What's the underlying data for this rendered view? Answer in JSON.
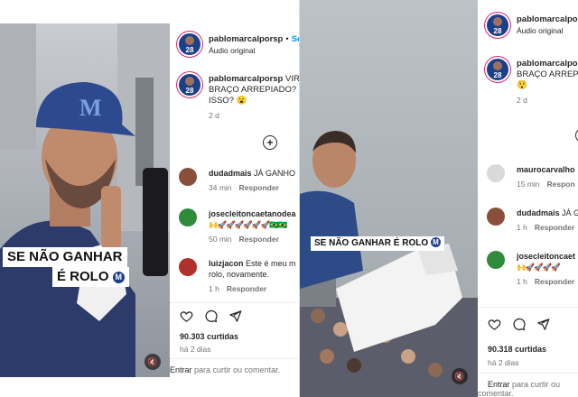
{
  "left": {
    "username": "pablomarcalporsp",
    "separator": "•",
    "follow": "Se",
    "audio": "Áudio original",
    "avatar_number": "28",
    "caption": {
      "lines": [
        "VIRA",
        "BRAÇO ARREPIADO? C",
        "ISSO? 😮"
      ],
      "time": "2 d"
    },
    "video_overlay": {
      "line1": "SE NÃO GANHAR",
      "line2": "É ROLO",
      "badge": "M"
    },
    "comments": [
      {
        "user": "dudadmais",
        "text": "JÁ GANHO",
        "time": "34 min",
        "reply": "Responder"
      },
      {
        "user": "josecleitoncaetanodea",
        "text": "🙌🚀🚀🚀🚀🚀🚀🇧🇷🇧🇷",
        "time": "50 min",
        "reply": "Responder"
      },
      {
        "user": "luizjacon",
        "text": "Este é meu m",
        "text2": "rolo, novamente.",
        "time": "1 h",
        "reply": "Responder"
      }
    ],
    "likes": "90.303 curtidas",
    "posted": "há 2 dias",
    "comment_bar": {
      "enter": "Entrar",
      "rest": "para curtir ou comentar."
    }
  },
  "right": {
    "username": "pablomarcalporsp",
    "audio": "Áudio original",
    "avatar_number": "28",
    "caption": {
      "lines": [
        "pablomarcalporsp",
        "BRAÇO ARREPIA",
        "😲"
      ],
      "time": "2 d"
    },
    "video_overlay": {
      "text": "SE NÃO GANHAR É ROLO",
      "badge": "M"
    },
    "comments": [
      {
        "user": "maurocarvalho",
        "text": "",
        "time": "15 min",
        "reply": "Respon"
      },
      {
        "user": "dudadmais",
        "text": "JÁ G",
        "time": "1 h",
        "reply": "Responder"
      },
      {
        "user": "josecleitoncaet",
        "text": "🙌🚀🚀🚀🚀",
        "time": "1 h",
        "reply": "Responder"
      }
    ],
    "likes": "90.318 curtidas",
    "posted": "há 2 dias",
    "comment_bar": {
      "enter": "Entrar",
      "rest": "para curtir ou comentar."
    }
  },
  "icons": [
    "heart-icon",
    "comment-icon",
    "share-icon",
    "add-comment-icon",
    "mute-icon",
    "avatar-icon"
  ],
  "colors": {
    "link_blue": "#0095f6",
    "story_ring": "#d62976",
    "brand_navy": "#1c3f8c",
    "muted_text": "#737373"
  }
}
